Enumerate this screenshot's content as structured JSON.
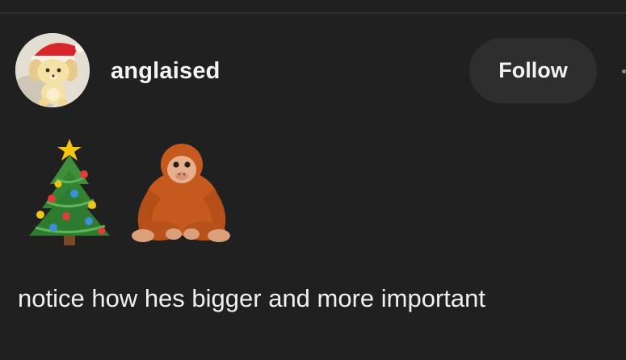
{
  "post": {
    "username": "anglaised",
    "follow_label": "Follow",
    "caption": "notice how hes bigger and more important"
  },
  "icons": {
    "avatar": "plush-dog-with-santa-hat",
    "emoji_1": "christmas-tree-emoji",
    "emoji_2": "orangutan-emoji",
    "more": "more-options-icon"
  },
  "colors": {
    "background": "#202020",
    "button_background": "#2e2e2e",
    "text": "#f4f4f4"
  }
}
